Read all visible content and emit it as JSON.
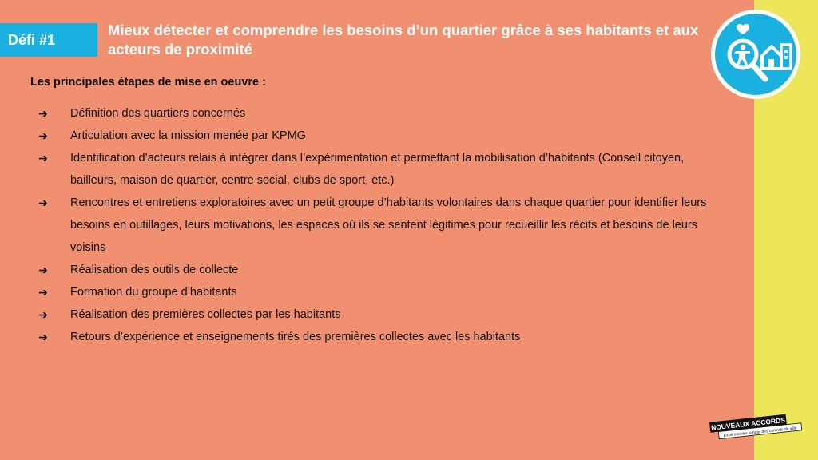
{
  "header": {
    "badge": "Défi #1",
    "title": "Mieux détecter et comprendre les besoins d’un quartier grâce à ses habitants et aux acteurs de proximité"
  },
  "section_title": "Les principales étapes de mise en oeuvre :",
  "arrow_glyph": "➔",
  "steps": [
    "Définition des quartiers concernés",
    "Articulation avec la mission menée par KPMG",
    "Identification d’acteurs relais à intégrer dans l’expérimentation et permettant la mobilisation d’habitants (Conseil citoyen, bailleurs, maison de quartier, centre social, clubs de sport, etc.)",
    "Rencontres et entretiens exploratoires avec un petit groupe d’habitants volontaires dans chaque quartier pour identifier leurs besoins en outillages, leurs motivations, les espaces où ils se sentent légitimes pour recueillir les récits et besoins de leurs voisins",
    "Réalisation des outils de collecte",
    "Formation du groupe d’habitants",
    "Réalisation des premières collectes par les habitants",
    "Retours d’expérience et enseignements tirés des premières collectes avec les habitants"
  ],
  "logo": {
    "name": "NOUVEAUX ACCORDS",
    "tagline": "Expérimenter le futur des contrats de ville"
  },
  "colors": {
    "background": "#f09070",
    "accent_blue": "#1ab0e0",
    "yellow": "#ede65a"
  },
  "icons": {
    "emblem": "magnifier-person-house-heart-icon"
  }
}
